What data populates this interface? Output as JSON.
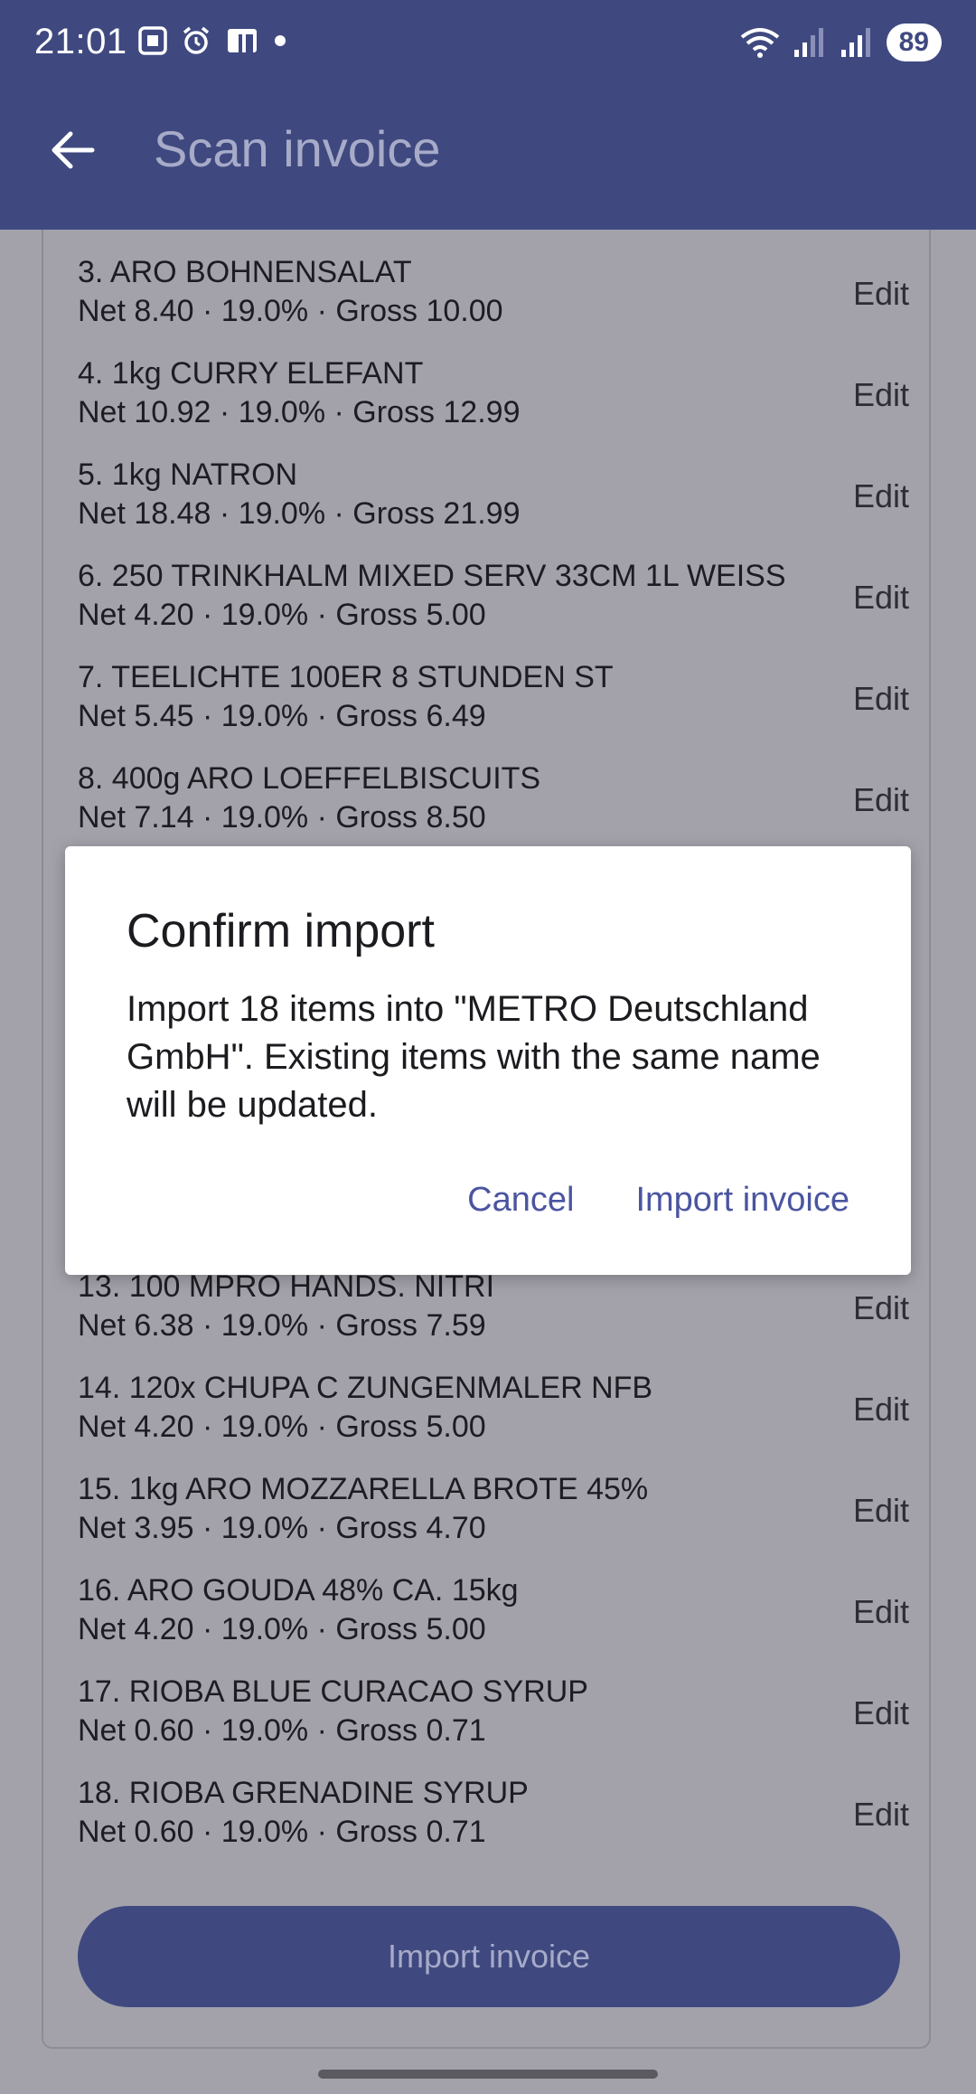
{
  "status_bar": {
    "time": "21:01",
    "battery": "89",
    "icons": [
      "screenshot-icon",
      "alarm-icon",
      "sim-icon",
      "dot-icon",
      "wifi-icon",
      "signal-icon"
    ]
  },
  "toolbar": {
    "title": "Scan invoice"
  },
  "items_top": [
    {
      "name": "3. ARO BOHNENSALAT",
      "meta": "Net 8.40 · 19.0% · Gross 10.00",
      "edit": "Edit"
    },
    {
      "name": "4. 1kg CURRY ELEFANT",
      "meta": "Net 10.92 · 19.0% · Gross 12.99",
      "edit": "Edit"
    },
    {
      "name": "5. 1kg NATRON",
      "meta": "Net 18.48 · 19.0% · Gross 21.99",
      "edit": "Edit"
    },
    {
      "name": "6. 250 TRINKHALM MIXED SERV 33CM 1L WEISS",
      "meta": "Net 4.20 · 19.0% · Gross 5.00",
      "edit": "Edit"
    },
    {
      "name": "7. TEELICHTE 100ER 8 STUNDEN ST",
      "meta": "Net 5.45 · 19.0% · Gross 6.49",
      "edit": "Edit"
    },
    {
      "name": "8. 400g ARO LOEFFELBISCUITS",
      "meta": "Net 7.14 · 19.0% · Gross 8.50",
      "edit": "Edit"
    }
  ],
  "items_bottom": [
    {
      "name": "13. 100 MPRO HANDS. NITRI",
      "meta": "Net 6.38 · 19.0% · Gross 7.59",
      "edit": "Edit"
    },
    {
      "name": "14. 120x CHUPA C ZUNGENMALER NFB",
      "meta": "Net 4.20 · 19.0% · Gross 5.00",
      "edit": "Edit"
    },
    {
      "name": "15. 1kg ARO MOZZARELLA BROTE 45%",
      "meta": "Net 3.95 · 19.0% · Gross 4.70",
      "edit": "Edit"
    },
    {
      "name": "16. ARO GOUDA 48% CA. 15kg",
      "meta": "Net 4.20 · 19.0% · Gross 5.00",
      "edit": "Edit"
    },
    {
      "name": "17. RIOBA BLUE CURACAO SYRUP",
      "meta": "Net 0.60 · 19.0% · Gross 0.71",
      "edit": "Edit"
    },
    {
      "name": "18. RIOBA GRENADINE SYRUP",
      "meta": "Net 0.60 · 19.0% · Gross 0.71",
      "edit": "Edit"
    }
  ],
  "import_button_label": "Import invoice",
  "dialog": {
    "title": "Confirm import",
    "body": "Import 18 items into \"METRO Deutschland GmbH\". Existing items with the same name will be updated.",
    "cancel_label": "Cancel",
    "confirm_label": "Import invoice"
  },
  "colors": {
    "primary": "#3f4980",
    "scrim_background": "#a3a2ab",
    "dialog_action": "#4a55a0"
  }
}
